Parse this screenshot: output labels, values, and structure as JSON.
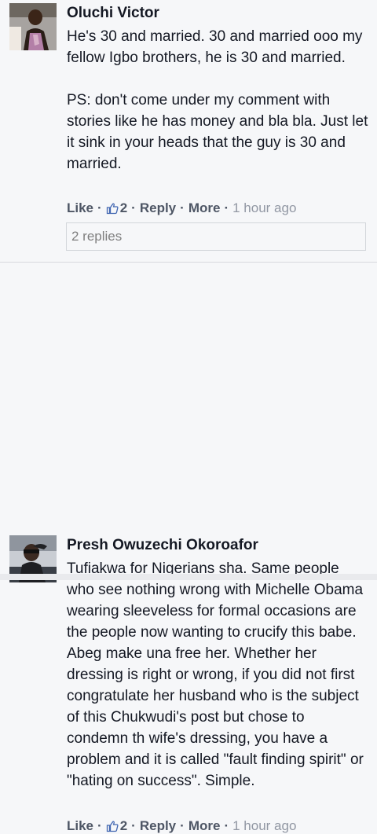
{
  "comments": [
    {
      "author": "Oluchi Victor",
      "text": "He's 30 and married. 30 and married ooo my fellow Igbo brothers, he is 30 and married.\n\nPS: don't come under my comment with stories like he has money and bla bla. Just let it sink in your heads that the guy is 30 and married.",
      "like_label": "Like",
      "like_count": "2",
      "reply_label": "Reply",
      "more_label": "More",
      "time": "1 hour ago",
      "replies_label": "2 replies"
    },
    {
      "author": "Presh Owuzechi Okoroafor",
      "text": "Tufiakwa for Nigerians sha. Same people who see nothing wrong with Michelle Obama wearing sleeveless for formal occasions are the people now wanting to crucify this babe. Abeg make una free her. Whether her dressing is right or wrong, if you did not first congratulate her husband who is the subject of this Chukwudi's post but chose to condemn th wife's dressing, you have a problem and it is called \"fault finding spirit\" or \"hating on success\". Simple.",
      "like_label": "Like",
      "like_count": "2",
      "reply_label": "Reply",
      "more_label": "More",
      "time": "1 hour ago"
    }
  ],
  "icons": {
    "like": "thumbs-up-icon"
  }
}
